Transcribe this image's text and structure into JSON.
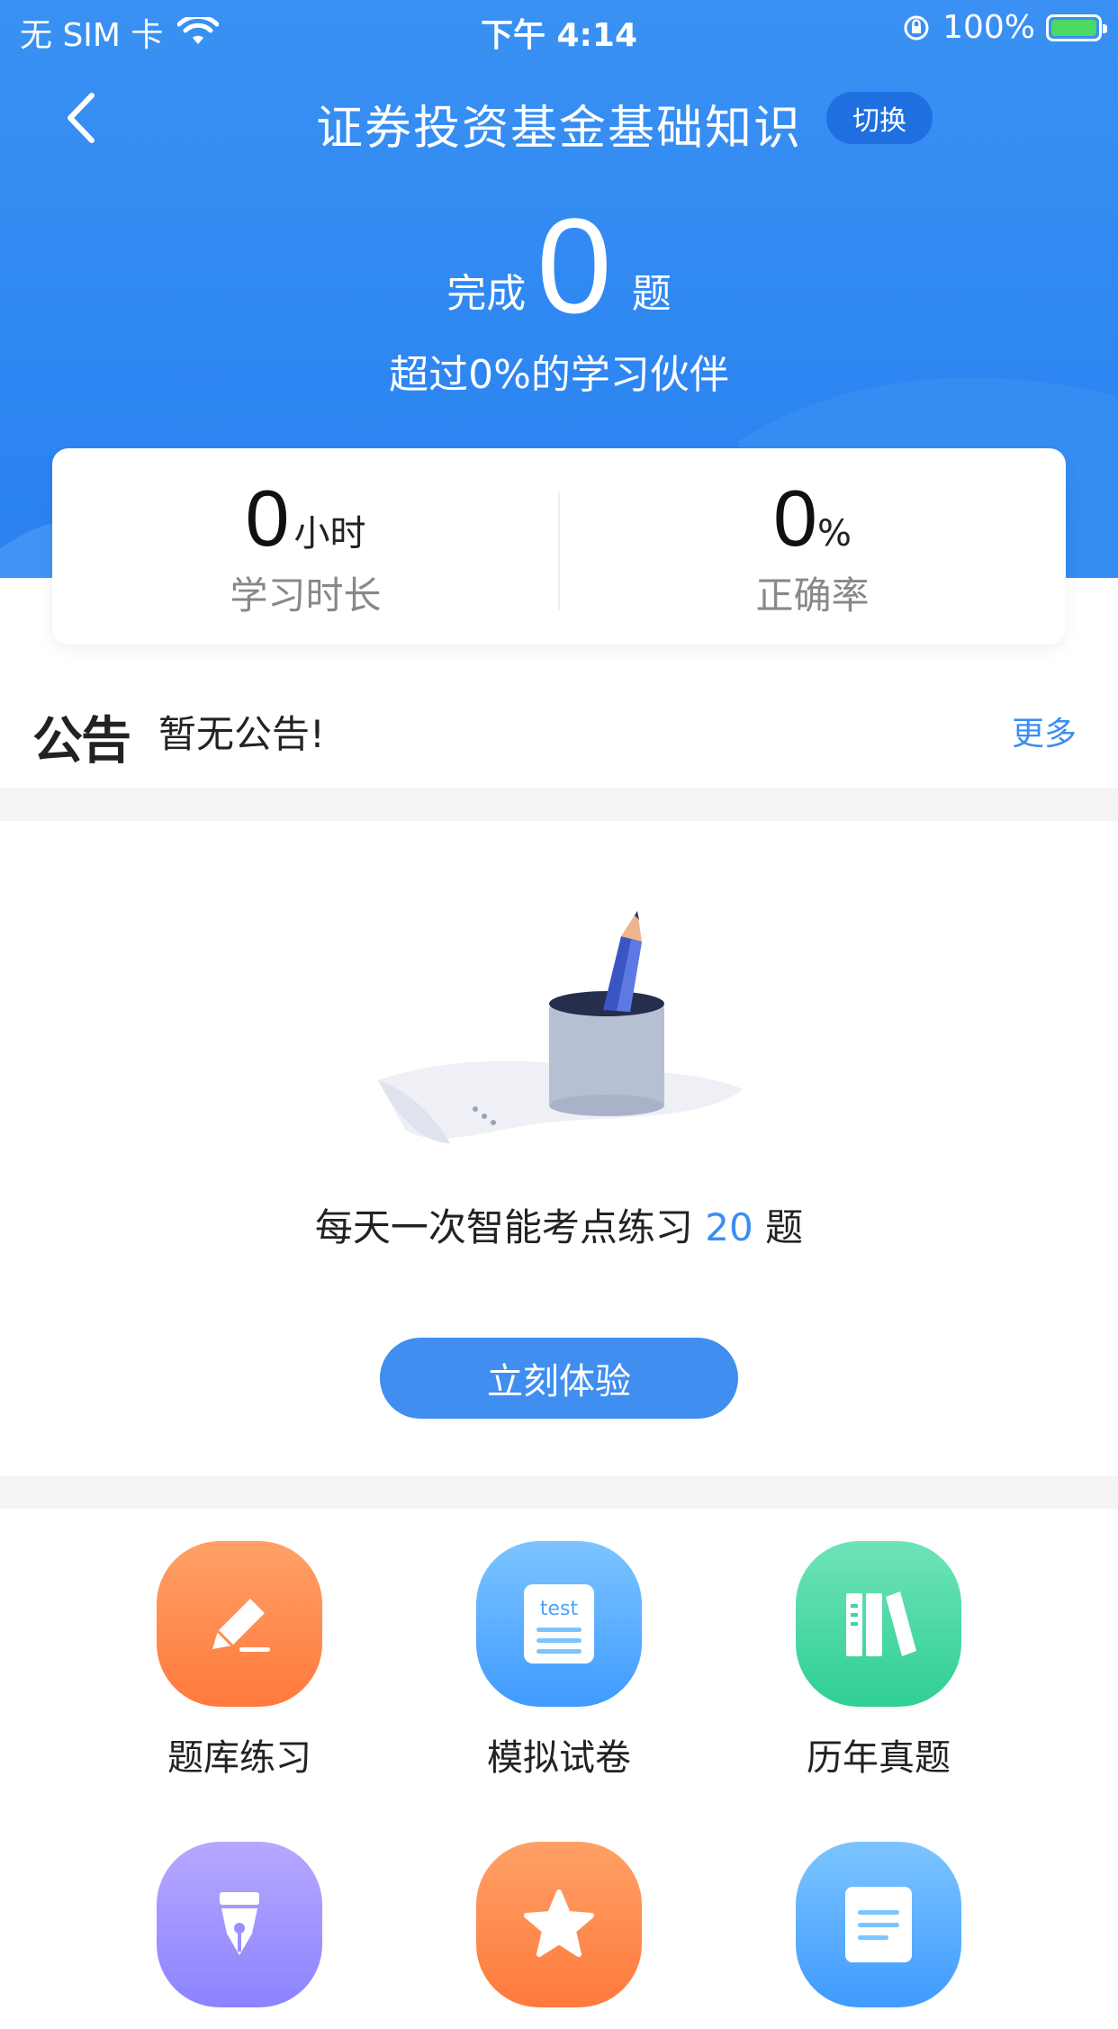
{
  "status_bar": {
    "carrier": "无 SIM 卡",
    "time": "下午 4:14",
    "battery": "100%"
  },
  "header": {
    "title": "证券投资基金基础知识",
    "switch_label": "切换"
  },
  "summary": {
    "done_prefix": "完成",
    "done_count": "0",
    "done_suffix": "题",
    "exceed_text": "超过0%的学习伙伴"
  },
  "stats": {
    "hours_value": "0",
    "hours_unit": "小时",
    "hours_label": "学习时长",
    "accuracy_value": "0",
    "accuracy_unit": "%",
    "accuracy_label": "正确率"
  },
  "notice": {
    "logo": "公告",
    "text": "暂无公告!",
    "more_label": "更多"
  },
  "practice": {
    "text_prefix": "每天一次智能考点练习",
    "count": "20",
    "text_suffix": "题",
    "cta_label": "立刻体验"
  },
  "grid": [
    {
      "label": "题库练习",
      "icon": "pencil-note-icon",
      "color_from": "#ffa066",
      "color_to": "#ff7a3c"
    },
    {
      "label": "模拟试卷",
      "icon": "test-paper-icon",
      "color_from": "#7cc4ff",
      "color_to": "#3f9bff"
    },
    {
      "label": "历年真题",
      "icon": "books-icon",
      "color_from": "#6fe3b8",
      "color_to": "#2fcf94"
    },
    {
      "label": "",
      "icon": "pen-nib-icon",
      "color_from": "#b6a8ff",
      "color_to": "#8c83ff"
    },
    {
      "label": "",
      "icon": "star-icon",
      "color_from": "#ffa066",
      "color_to": "#ff7a3c"
    },
    {
      "label": "",
      "icon": "document-icon",
      "color_from": "#7cc4ff",
      "color_to": "#3f9bff"
    }
  ],
  "colors": {
    "brand_blue": "#2f87f2",
    "accent_blue": "#3a8ef0"
  }
}
